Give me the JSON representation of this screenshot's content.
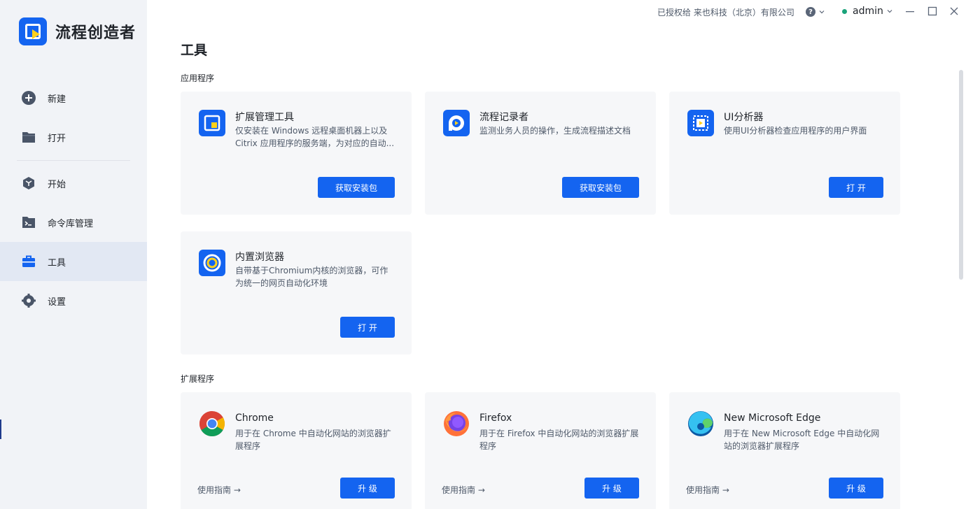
{
  "app": {
    "name": "流程创造者"
  },
  "topbar": {
    "license": "已授权给 来也科技（北京）有限公司",
    "user": "admin"
  },
  "sidebar": {
    "items": [
      {
        "label": "新建",
        "icon": "plus-circle-icon"
      },
      {
        "label": "打开",
        "icon": "folder-icon"
      },
      {
        "label": "开始",
        "icon": "cube-icon"
      },
      {
        "label": "命令库管理",
        "icon": "terminal-folder-icon"
      },
      {
        "label": "工具",
        "icon": "toolbox-icon",
        "active": true
      },
      {
        "label": "设置",
        "icon": "gear-icon"
      }
    ]
  },
  "main": {
    "title": "工具",
    "apps_section": "应用程序",
    "ext_section": "扩展程序",
    "apps": [
      {
        "title": "扩展管理工具",
        "desc": "仅安装在 Windows 远程桌面机器上以及 Citrix 应用程序的服务端，为对应的自动...",
        "button": "获取安装包"
      },
      {
        "title": "流程记录者",
        "desc": "监测业务人员的操作，生成流程描述文档",
        "button": "获取安装包"
      },
      {
        "title": "UI分析器",
        "desc": "使用UI分析器检查应用程序的用户界面",
        "button": "打 开"
      },
      {
        "title": "内置浏览器",
        "desc": "自带基于Chromium内核的浏览器，可作为统一的网页自动化环境",
        "button": "打 开"
      }
    ],
    "extensions": [
      {
        "title": "Chrome",
        "desc": "用于在 Chrome 中自动化网站的浏览器扩展程序",
        "guide": "使用指南 →",
        "button": "升 级"
      },
      {
        "title": "Firefox",
        "desc": "用于在 Firefox 中自动化网站的浏览器扩展程序",
        "guide": "使用指南 →",
        "button": "升 级"
      },
      {
        "title": "New Microsoft Edge",
        "desc": "用于在 New Microsoft Edge 中自动化网站的浏览器扩展程序",
        "guide": "使用指南 →",
        "button": "升 级"
      }
    ]
  },
  "colors": {
    "primary": "#1464f0",
    "sidebar_bg": "#f1f3f7",
    "card_bg": "#f6f7f9"
  }
}
